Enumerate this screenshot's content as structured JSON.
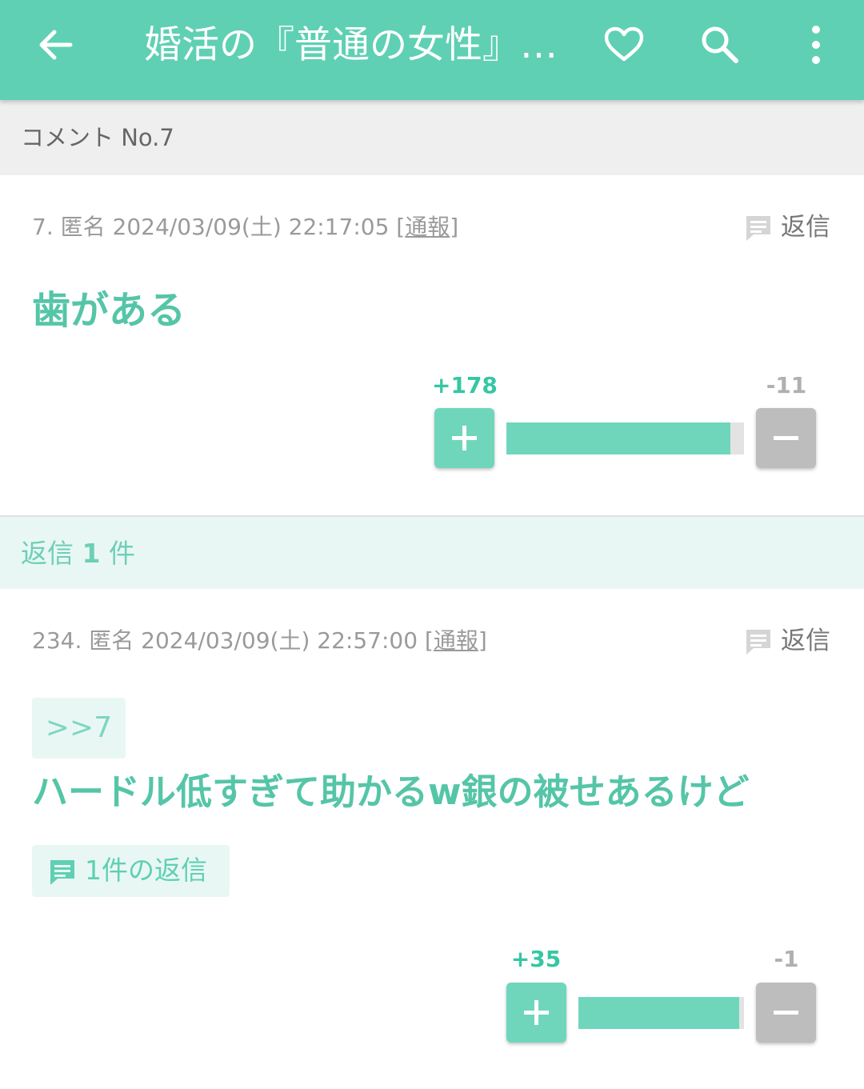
{
  "appbar": {
    "title": "婚活の『普通の女性』…",
    "icons": [
      "back-arrow-icon",
      "heart-icon",
      "search-icon",
      "more-vert-icon"
    ],
    "color": "#5fd0b3"
  },
  "section_header": "コメント No.7",
  "comments": [
    {
      "meta_prefix": "7. 匿名 2024/03/09(土) 22:17:05 [",
      "report_label": "通報",
      "meta_suffix": "]",
      "reply_label": "返信",
      "body": "歯がある",
      "plus_label": "+178",
      "minus_label": "-11",
      "plus_value": 178,
      "minus_value": 11
    },
    {
      "meta_prefix": "234. 匿名 2024/03/09(土) 22:57:00 [",
      "report_label": "通報",
      "meta_suffix": "]",
      "reply_label": "返信",
      "anchor": ">>7",
      "body": "ハードル低すぎて助かるw銀の被せあるけど",
      "reply_count_label": "1件の返信",
      "plus_label": "+35",
      "minus_label": "-1",
      "plus_value": 35,
      "minus_value": 1
    }
  ],
  "replies_header": {
    "prefix": "返信 ",
    "count": "1",
    "suffix": " 件"
  },
  "colors": {
    "accent": "#5fd0b3",
    "plus": "#6fd6bc",
    "minus": "#bdbdbd",
    "reply_bg": "#e9f7f4"
  }
}
